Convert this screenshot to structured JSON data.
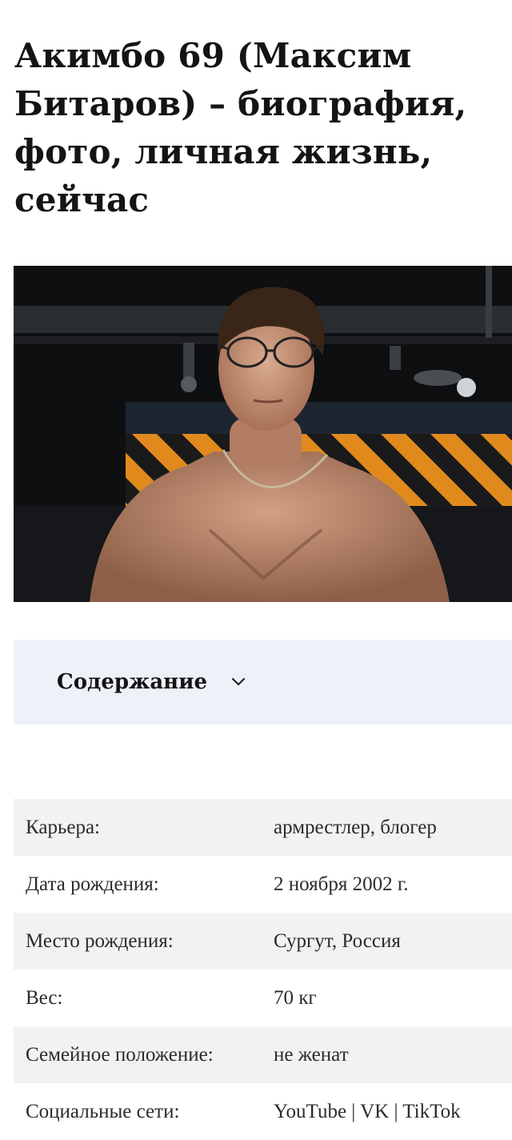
{
  "article": {
    "title": "Акимбо 69 (Максим Битаров) – биография, фото, личная жизнь, сейчас"
  },
  "hero_image": {
    "icon": "photo-person"
  },
  "toc": {
    "label": "Содержание",
    "icon": "chevron-down-icon"
  },
  "info": {
    "rows": [
      {
        "label": "Карьера:",
        "value": "армрестлер, блогер"
      },
      {
        "label": "Дата рождения:",
        "value": "2 ноября 2002 г."
      },
      {
        "label": "Место рождения:",
        "value": "Сургут, Россия"
      },
      {
        "label": "Вес:",
        "value": "70 кг"
      },
      {
        "label": "Семейное положение:",
        "value": "не женат"
      },
      {
        "label": "Социальные сети:",
        "links": [
          "YouTube",
          "VK",
          "TikTok"
        ],
        "separator": " | "
      }
    ]
  },
  "colors": {
    "toc_background": "#eef2f8",
    "row_stripe": "#f2f2f2",
    "hazard_orange": "#e08a1e"
  }
}
